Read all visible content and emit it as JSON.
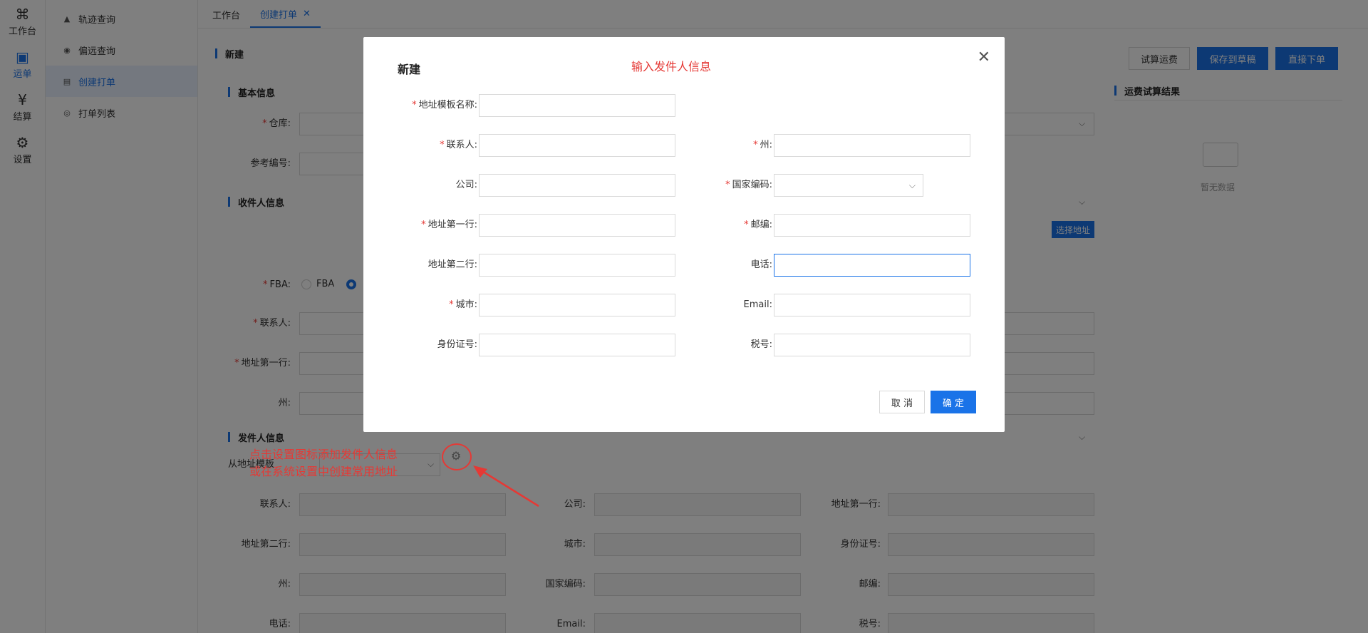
{
  "rail": [
    {
      "label": "工作台",
      "icon": "clover-icon"
    },
    {
      "label": "运单",
      "icon": "waybill-icon"
    },
    {
      "label": "结算",
      "icon": "yuan-icon"
    },
    {
      "label": "设置",
      "icon": "gear-icon"
    }
  ],
  "submenu": [
    {
      "label": "轨迹查询",
      "icon": "triangle-icon"
    },
    {
      "label": "偏远查询",
      "icon": "target-icon"
    },
    {
      "label": "创建打单",
      "icon": "form-icon"
    },
    {
      "label": "打单列表",
      "icon": "list-icon"
    }
  ],
  "tabs": [
    {
      "label": "工作台"
    },
    {
      "label": "创建打单"
    }
  ],
  "page": {
    "title": "新建",
    "btn_estimate": "试算运费",
    "btn_save_draft": "保存到草稿",
    "btn_order": "直接下单",
    "result_title": "运费试算结果",
    "no_data": "暂无数据"
  },
  "basic": {
    "title": "基本信息",
    "warehouse": "仓库:",
    "ref": "参考编号:"
  },
  "receiver": {
    "title": "收件人信息",
    "select_address": "选择地址",
    "fba": "FBA:",
    "fba_option": "FBA",
    "contact": "联系人:",
    "addr1": "地址第一行:",
    "state": "州:"
  },
  "sender": {
    "title": "发件人信息",
    "from_template": "从地址模板",
    "contact": "联系人:",
    "company": "公司:",
    "addr1": "地址第一行:",
    "addr2": "地址第二行:",
    "city": "城市:",
    "idcard": "身份证号:",
    "state": "州:",
    "country": "国家编码:",
    "zip": "邮编:",
    "phone": "电话:",
    "email": "Email:",
    "tax": "税号:"
  },
  "annotation": {
    "line1": "点击设置图标添加发件人信息",
    "line2": "或在系统设置中创建常用地址"
  },
  "modal": {
    "title": "新建",
    "note": "输入发件人信息",
    "template_name": "地址模板名称:",
    "contact": "联系人:",
    "state": "州:",
    "company": "公司:",
    "country": "国家编码:",
    "addr1": "地址第一行:",
    "zip": "邮编:",
    "addr2": "地址第二行:",
    "phone": "电话:",
    "city": "城市:",
    "email": "Email:",
    "idcard": "身份证号:",
    "tax": "税号:",
    "cancel": "取 消",
    "confirm": "确 定"
  }
}
